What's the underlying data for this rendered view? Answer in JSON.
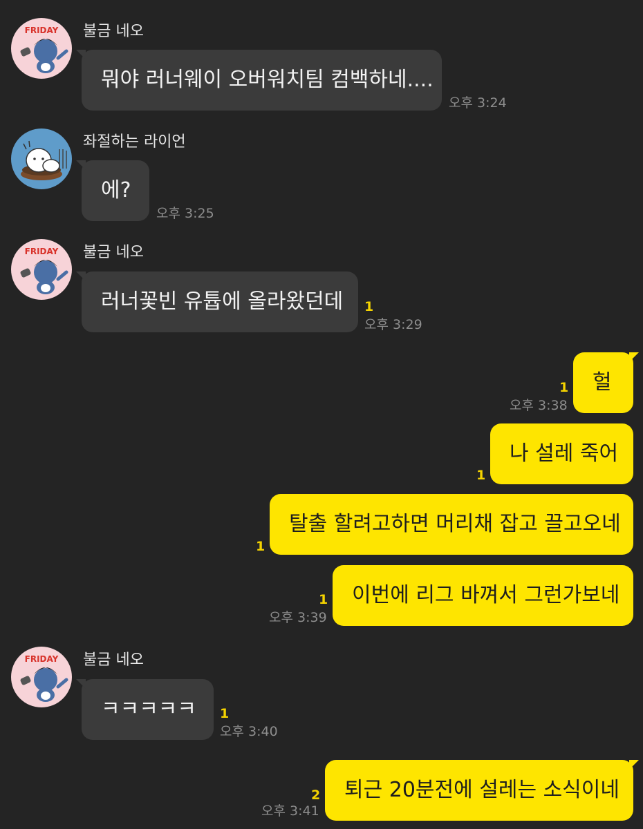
{
  "messages": [
    {
      "sender": "불금 네오",
      "text": "뭐야 러너웨이 오버워치팀 컴백하네....",
      "time": "오후 3:24"
    },
    {
      "sender": "좌절하는 라이언",
      "text": "에?",
      "time": "오후 3:25"
    },
    {
      "sender": "불금 네오",
      "text": "러너꽃빈 유튭에 올라왔던데",
      "unread": "1",
      "time": "오후 3:29"
    },
    {
      "text": "헐",
      "unread": "1",
      "time": "오후 3:38"
    },
    {
      "text": "나 설레 죽어",
      "unread": "1"
    },
    {
      "text": "탈출 할려고하면 머리채 잡고 끌고오네",
      "unread": "1"
    },
    {
      "text": "이번에 리그 바껴서 그런가보네",
      "unread": "1",
      "time": "오후 3:39"
    },
    {
      "sender": "불금 네오",
      "text": "ㅋㅋㅋㅋㅋ",
      "unread": "1",
      "time": "오후 3:40"
    },
    {
      "text": "퇴근 20분전에 설레는 소식이네",
      "unread": "2",
      "time": "오후 3:41"
    }
  ],
  "avatar_labels": {
    "friday": "FRIDAY"
  },
  "colors": {
    "background": "#242424",
    "incoming_bubble": "#3b3b3b",
    "outgoing_bubble": "#fee500",
    "unread": "#f5d300"
  }
}
